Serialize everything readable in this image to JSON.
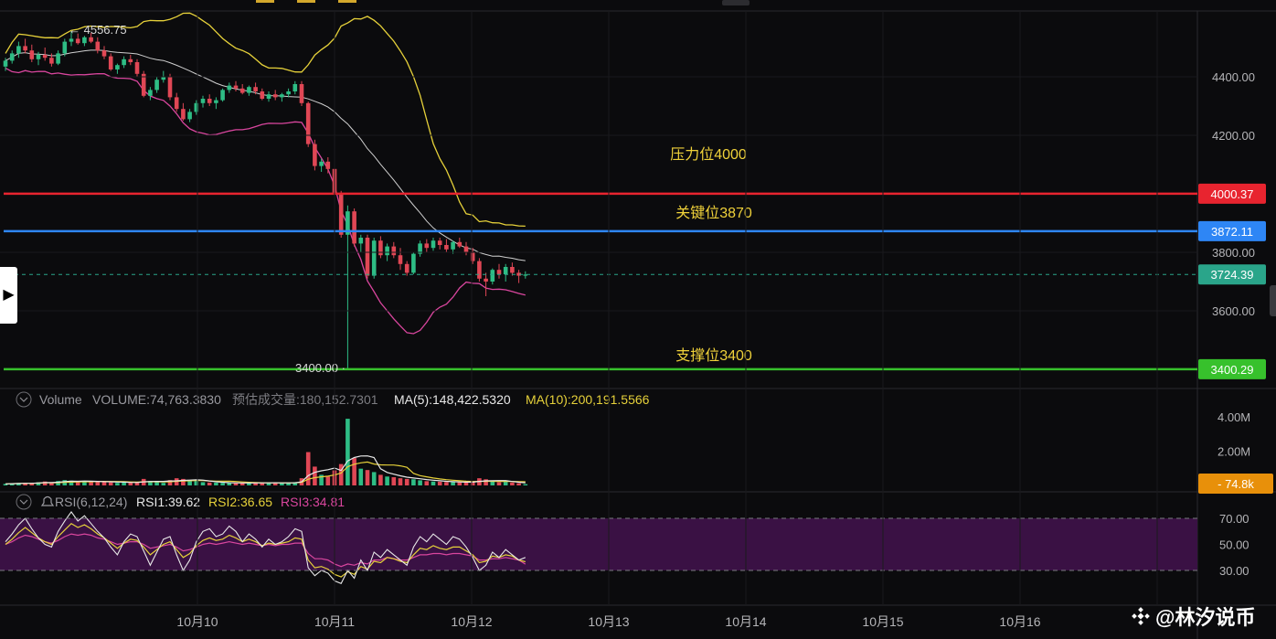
{
  "chart_data": [
    {
      "type": "candlestick",
      "panel": "price",
      "ylim": [
        3390,
        4580
      ],
      "yticks": [
        "4400.00",
        "4200.00",
        "3800.00",
        "3600.00"
      ],
      "ytick_values": [
        4400,
        4200,
        3800,
        3600
      ],
      "xticks": [
        "10月10",
        "10月11",
        "10月12",
        "10月13",
        "10月14",
        "10月15",
        "10月16"
      ],
      "annotations": {
        "high_label": "← 4556.75",
        "low_label": "3400.00 ·",
        "resistance": "压力位4000",
        "key": "关键位3870",
        "support": "支撑位3400"
      },
      "levels": [
        {
          "name": "resistance",
          "value": 4000.37,
          "label": "4000.37",
          "color": "#e8242f"
        },
        {
          "name": "key",
          "value": 3872.11,
          "label": "3872.11",
          "color": "#2e86f5"
        },
        {
          "name": "current",
          "value": 3724.39,
          "label": "3724.39",
          "color": "#2aa58a"
        },
        {
          "name": "support",
          "value": 3400.29,
          "label": "3400.29",
          "color": "#37c12c"
        }
      ],
      "candles": [
        [
          4435,
          4465,
          4420,
          4455
        ],
        [
          4455,
          4490,
          4445,
          4480
        ],
        [
          4480,
          4520,
          4465,
          4505
        ],
        [
          4505,
          4530,
          4480,
          4490
        ],
        [
          4490,
          4510,
          4450,
          4460
        ],
        [
          4460,
          4485,
          4440,
          4475
        ],
        [
          4475,
          4500,
          4455,
          4465
        ],
        [
          4465,
          4480,
          4435,
          4445
        ],
        [
          4445,
          4490,
          4440,
          4480
        ],
        [
          4480,
          4530,
          4470,
          4520
        ],
        [
          4520,
          4556,
          4505,
          4530
        ],
        [
          4530,
          4548,
          4510,
          4515
        ],
        [
          4515,
          4540,
          4505,
          4535
        ],
        [
          4535,
          4550,
          4515,
          4520
        ],
        [
          4520,
          4535,
          4480,
          4490
        ],
        [
          4490,
          4505,
          4460,
          4470
        ],
        [
          4470,
          4480,
          4420,
          4425
        ],
        [
          4425,
          4445,
          4410,
          4440
        ],
        [
          4440,
          4470,
          4430,
          4460
        ],
        [
          4460,
          4475,
          4440,
          4450
        ],
        [
          4450,
          4460,
          4400,
          4410
        ],
        [
          4410,
          4420,
          4330,
          4335
        ],
        [
          4335,
          4365,
          4320,
          4355
        ],
        [
          4355,
          4400,
          4345,
          4390
        ],
        [
          4390,
          4420,
          4380,
          4400
        ],
        [
          4400,
          4410,
          4320,
          4330
        ],
        [
          4330,
          4345,
          4280,
          4290
        ],
        [
          4290,
          4310,
          4250,
          4255
        ],
        [
          4255,
          4290,
          4245,
          4280
        ],
        [
          4280,
          4320,
          4270,
          4310
        ],
        [
          4310,
          4335,
          4295,
          4325
        ],
        [
          4325,
          4340,
          4300,
          4310
        ],
        [
          4310,
          4330,
          4290,
          4320
        ],
        [
          4320,
          4360,
          4315,
          4355
        ],
        [
          4355,
          4380,
          4345,
          4370
        ],
        [
          4370,
          4385,
          4350,
          4360
        ],
        [
          4360,
          4375,
          4340,
          4345
        ],
        [
          4345,
          4370,
          4335,
          4365
        ],
        [
          4365,
          4380,
          4340,
          4350
        ],
        [
          4350,
          4360,
          4320,
          4325
        ],
        [
          4325,
          4350,
          4315,
          4340
        ],
        [
          4340,
          4355,
          4320,
          4330
        ],
        [
          4330,
          4345,
          4315,
          4340
        ],
        [
          4340,
          4360,
          4330,
          4350
        ],
        [
          4350,
          4385,
          4340,
          4375
        ],
        [
          4375,
          4385,
          4300,
          4310
        ],
        [
          4310,
          4315,
          4160,
          4170
        ],
        [
          4170,
          4185,
          4080,
          4095
        ],
        [
          4095,
          4120,
          4075,
          4110
        ],
        [
          4110,
          4125,
          4070,
          4085
        ],
        [
          4085,
          4090,
          3990,
          4000
        ],
        [
          4000,
          4010,
          3850,
          3860
        ],
        [
          3860,
          3960,
          3400,
          3940
        ],
        [
          3940,
          3950,
          3820,
          3830
        ],
        [
          3830,
          3860,
          3800,
          3850
        ],
        [
          3850,
          3860,
          3710,
          3720
        ],
        [
          3720,
          3850,
          3710,
          3840
        ],
        [
          3840,
          3855,
          3780,
          3790
        ],
        [
          3790,
          3830,
          3770,
          3820
        ],
        [
          3820,
          3835,
          3780,
          3790
        ],
        [
          3790,
          3815,
          3740,
          3760
        ],
        [
          3760,
          3770,
          3720,
          3730
        ],
        [
          3730,
          3800,
          3725,
          3795
        ],
        [
          3795,
          3840,
          3785,
          3830
        ],
        [
          3830,
          3845,
          3800,
          3815
        ],
        [
          3815,
          3850,
          3805,
          3840
        ],
        [
          3840,
          3850,
          3810,
          3825
        ],
        [
          3825,
          3845,
          3800,
          3810
        ],
        [
          3810,
          3840,
          3795,
          3835
        ],
        [
          3835,
          3850,
          3815,
          3820
        ],
        [
          3820,
          3835,
          3790,
          3800
        ],
        [
          3800,
          3815,
          3760,
          3770
        ],
        [
          3770,
          3780,
          3700,
          3710
        ],
        [
          3710,
          3730,
          3650,
          3700
        ],
        [
          3700,
          3745,
          3690,
          3740
        ],
        [
          3740,
          3760,
          3710,
          3725
        ],
        [
          3725,
          3760,
          3700,
          3750
        ],
        [
          3750,
          3765,
          3720,
          3730
        ],
        [
          3730,
          3740,
          3695,
          3720
        ],
        [
          3720,
          3735,
          3710,
          3724
        ]
      ],
      "volume_panel": {
        "label": "Volume",
        "volume": "VOLUME:74,763.3830",
        "predicted": "预估成交量:180,152.7301",
        "ma5": "MA(5):148,422.5320",
        "ma10": "MA(10):200,191.5566",
        "yticks": [
          "4.00M",
          "2.00M"
        ],
        "ytick_values": [
          4000000,
          2000000
        ],
        "ylim": [
          0,
          4600000
        ],
        "last_label": "74.8k",
        "values": [
          90000,
          110000,
          140000,
          160000,
          120000,
          180000,
          230000,
          150000,
          260000,
          310000,
          280000,
          200000,
          240000,
          190000,
          260000,
          210000,
          180000,
          150000,
          170000,
          160000,
          190000,
          380000,
          260000,
          200000,
          150000,
          310000,
          420000,
          380000,
          300000,
          260000,
          190000,
          170000,
          160000,
          150000,
          140000,
          130000,
          140000,
          160000,
          150000,
          170000,
          140000,
          150000,
          130000,
          160000,
          190000,
          420000,
          1950000,
          1100000,
          620000,
          520000,
          880000,
          1250000,
          3900000,
          1600000,
          980000,
          900000,
          780000,
          620000,
          520000,
          480000,
          420000,
          380000,
          360000,
          300000,
          250000,
          230000,
          220000,
          200000,
          190000,
          180000,
          170000,
          210000,
          420000,
          360000,
          230000,
          190000,
          210000,
          170000,
          130000,
          75000
        ]
      },
      "rsi_panel": {
        "label": "RSI(6,12,24)",
        "rsi1": "RSI1:39.62",
        "rsi2": "RSI2:36.65",
        "rsi3": "RSI3:34.81",
        "yticks": [
          "70.00",
          "50.00",
          "30.00"
        ],
        "ytick_values": [
          70,
          50,
          30
        ],
        "ylim": [
          10,
          82
        ],
        "rsi1_values": [
          52,
          58,
          65,
          70,
          62,
          55,
          50,
          48,
          60,
          68,
          75,
          68,
          72,
          66,
          60,
          55,
          48,
          42,
          52,
          58,
          56,
          45,
          34,
          44,
          54,
          56,
          42,
          30,
          38,
          52,
          60,
          62,
          56,
          58,
          64,
          60,
          52,
          58,
          54,
          48,
          54,
          50,
          52,
          56,
          62,
          60,
          32,
          26,
          30,
          28,
          22,
          20,
          30,
          24,
          38,
          30,
          44,
          40,
          46,
          42,
          38,
          34,
          48,
          56,
          52,
          58,
          54,
          50,
          56,
          54,
          48,
          40,
          30,
          34,
          44,
          40,
          46,
          42,
          38,
          40
        ],
        "rsi2_values": [
          50,
          54,
          59,
          63,
          59,
          55,
          52,
          50,
          56,
          61,
          66,
          63,
          65,
          62,
          58,
          55,
          51,
          47,
          51,
          54,
          53,
          48,
          42,
          46,
          50,
          52,
          46,
          40,
          43,
          49,
          53,
          55,
          53,
          54,
          57,
          55,
          52,
          54,
          52,
          49,
          51,
          50,
          51,
          52,
          55,
          54,
          38,
          32,
          33,
          31,
          27,
          25,
          29,
          27,
          33,
          31,
          37,
          36,
          40,
          39,
          37,
          36,
          42,
          47,
          46,
          49,
          47,
          46,
          48,
          48,
          45,
          42,
          36,
          37,
          41,
          40,
          42,
          41,
          38,
          36.65
        ],
        "rsi3_values": [
          50,
          52,
          55,
          57,
          56,
          54,
          52,
          51,
          53,
          56,
          58,
          57,
          58,
          57,
          55,
          54,
          52,
          50,
          51,
          52,
          52,
          50,
          47,
          48,
          49,
          50,
          48,
          45,
          46,
          48,
          50,
          51,
          50,
          51,
          52,
          51,
          50,
          51,
          50,
          49,
          50,
          49,
          50,
          50,
          51,
          51,
          43,
          39,
          39,
          38,
          35,
          33,
          35,
          34,
          36,
          35,
          38,
          38,
          40,
          39,
          38,
          38,
          40,
          42,
          42,
          43,
          43,
          42,
          43,
          43,
          42,
          41,
          38,
          38,
          39,
          39,
          40,
          39,
          38,
          34.81
        ]
      }
    }
  ],
  "watermark": {
    "text": "@林汐说币"
  },
  "nav": {
    "side_toggle": "▶"
  }
}
